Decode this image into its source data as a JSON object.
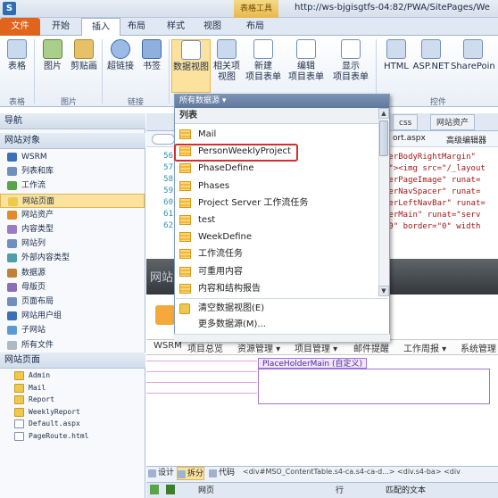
{
  "title_bar": {
    "context_tab_header": "表格工具",
    "url": "http://ws-bjgisgtfs-04:82/PWA/SitePages/We"
  },
  "ribbon_tabs": [
    "文件",
    "开始",
    "插入",
    "布局",
    "样式",
    "视图",
    "布局"
  ],
  "ribbon": {
    "buttons": {
      "table": "表格",
      "picture": "图片",
      "clipart": "剪贴画",
      "hyperlink": "超链接",
      "bookmark": "书签",
      "dataview": "数据视图",
      "related_view_1": "相关项",
      "related_view_2": "视图",
      "new_item_1": "新建",
      "new_item_2": "项目表单",
      "edit_item_1": "编辑",
      "edit_item_2": "项目表单",
      "display_item_1": "显示",
      "display_item_2": "项目表单",
      "html": "HTML",
      "aspnet": "ASP.NET",
      "sharepoint": "SharePoin"
    },
    "groups": {
      "tables": "表格",
      "pictures": "图片",
      "links": "链接",
      "controls": "控件"
    }
  },
  "nav": {
    "header": "导航",
    "site_objects_header": "网站对象",
    "items": [
      "WSRM",
      "列表和库",
      "工作流",
      "网站页面",
      "网站资产",
      "内容类型",
      "网站列",
      "外部内容类型",
      "数据源",
      "母版页",
      "页面布局",
      "网站用户组",
      "子网站",
      "所有文件"
    ],
    "selected": "网站页面",
    "pages_header": "网站页面",
    "files": [
      "Admin",
      "Mail",
      "Report",
      "WeeklyReport",
      "Default.aspx",
      "PageRoute.html"
    ]
  },
  "editor": {
    "doc_tabs": [
      "css",
      "网站资产"
    ],
    "breadcrumb": [
      "ort.aspx",
      "高级编辑器"
    ],
    "line_numbers": [
      "56",
      "57",
      "58",
      "59",
      "60",
      "61",
      "62"
    ],
    "code_lines": [
      "derBodyRightMargin\"",
      "g\"><img src=\"/_layout",
      "derPageImage\" runat=",
      "derNavSpacer\" runat=",
      "derLeftNavBar\" runat=",
      "derMain\" runat=\"serv",
      "\"0\" border=\"0\" width"
    ],
    "banner_title": "网站页",
    "top_nav": [
      "WSRM",
      "项目总览",
      "资源管理 ▾",
      "项目管理 ▾",
      "邮件提醒",
      "工作周报 ▾",
      "系统管理"
    ],
    "placeholder_label": "PlaceHolderMain (自定义)"
  },
  "view_bar": {
    "design": "设计",
    "split": "拆分",
    "code": "代码",
    "tag_path": "<div#MSO_ContentTable.s4-ca.s4-ca-d...> <div.s4-ba> <div"
  },
  "status_bar": {
    "mode": "网页",
    "row_label": "行",
    "match_text_label": "匹配的文本"
  },
  "dropdown": {
    "header": "所有数据源 ▾",
    "list_header": "列表",
    "items": [
      "Mail",
      "PersonWeeklyProject",
      "PhaseDefine",
      "Phases",
      "Project Server 工作流任务",
      "test",
      "WeekDefine",
      "工作流任务",
      "可重用内容",
      "内容和结构报告"
    ],
    "highlighted_item": "PersonWeeklyProject",
    "actions": [
      "清空数据视图(E)",
      "更多数据源(M)..."
    ]
  },
  "colors": {
    "file_tab": "#e0641c",
    "selection": "#fbe39f",
    "highlight_border": "#d32f2f",
    "placeholder_border": "#a072d6"
  }
}
